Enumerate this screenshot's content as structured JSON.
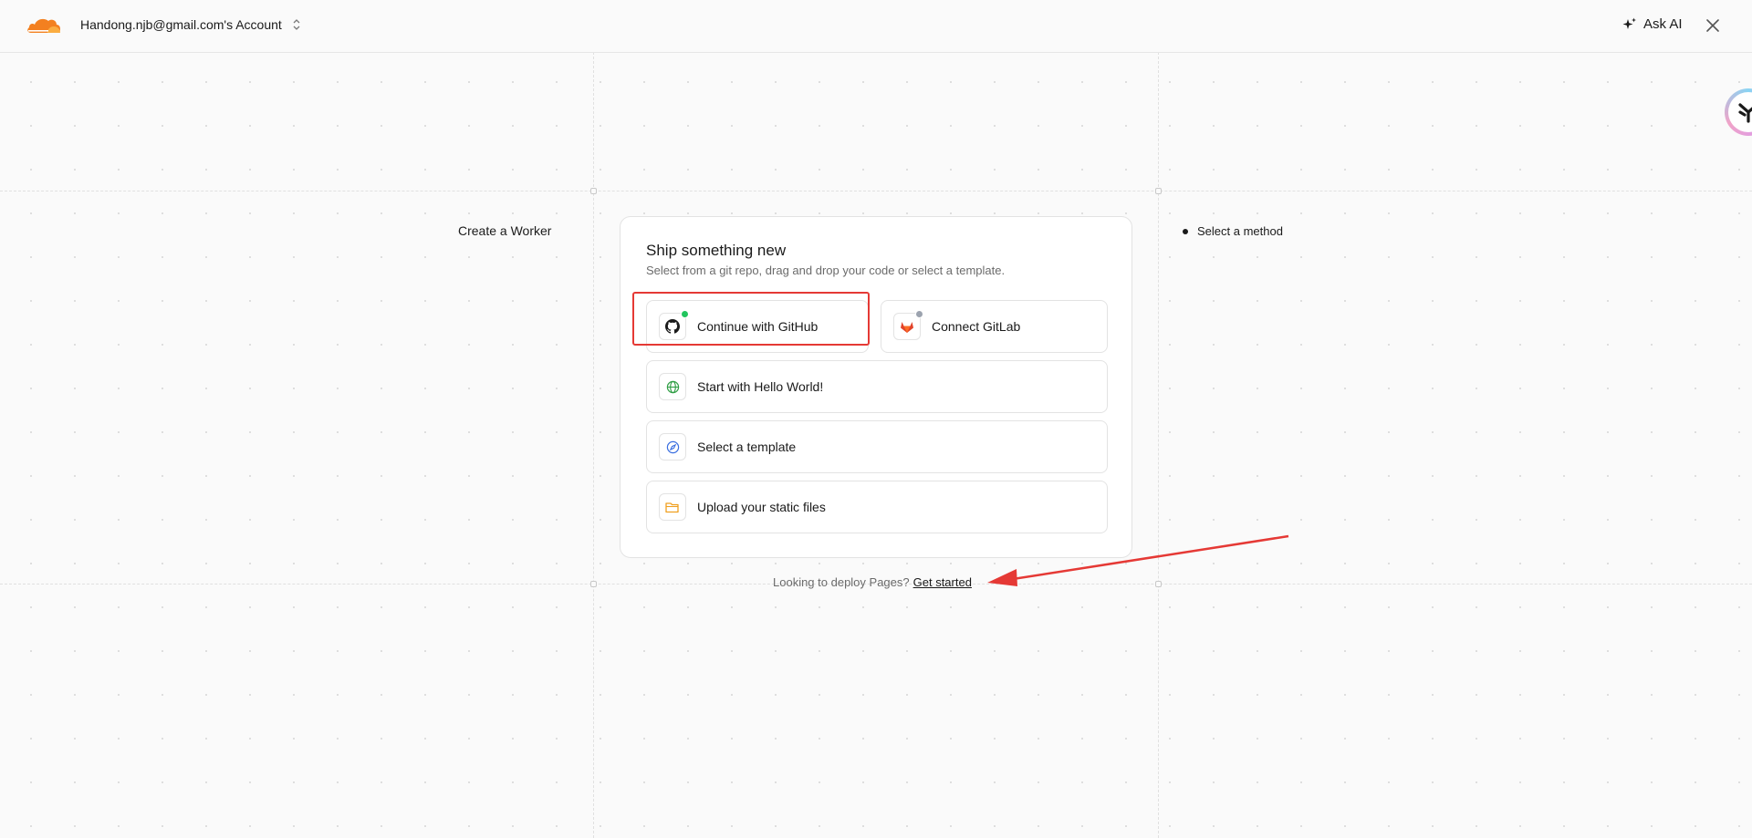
{
  "header": {
    "account_label": "Handong.njb@gmail.com's Account",
    "ask_ai_label": "Ask AI"
  },
  "left_label": "Create a Worker",
  "steps": [
    {
      "label": "Select a method",
      "active": true
    }
  ],
  "card": {
    "title": "Ship something new",
    "subtitle": "Select from a git repo, drag and drop your code or select a template.",
    "options": {
      "github": {
        "label": "Continue with GitHub",
        "icon": "github-icon",
        "status_color": "#22c55e"
      },
      "gitlab": {
        "label": "Connect GitLab",
        "icon": "gitlab-icon",
        "status_color": "#9ca3af"
      },
      "hello_world": {
        "label": "Start with Hello World!",
        "icon": "globe-icon",
        "color": "#2f9e44"
      },
      "template": {
        "label": "Select a template",
        "icon": "compass-icon",
        "color": "#3b6fe0"
      },
      "upload": {
        "label": "Upload your static files",
        "icon": "folder-icon",
        "color": "#f0a020"
      }
    }
  },
  "pages_prompt": {
    "text": "Looking to deploy Pages?",
    "link": "Get started"
  },
  "colors": {
    "brand_orange": "#f38020",
    "annotation_red": "#e53935"
  }
}
